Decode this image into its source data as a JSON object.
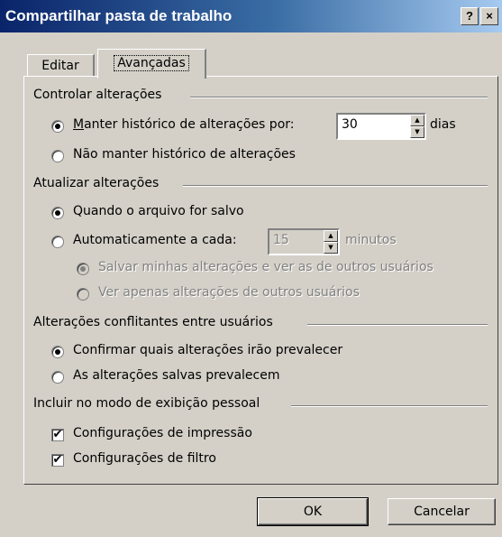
{
  "window": {
    "title": "Compartilhar pasta de trabalho",
    "help_label": "?",
    "close_label": "×"
  },
  "tabs": [
    {
      "label": "Editar"
    },
    {
      "label": "Avançadas"
    }
  ],
  "controlar": {
    "title": "Controlar alterações",
    "manter_historico": {
      "label": "Manter histórico de alterações por:",
      "checked": true
    },
    "dias_value": "30",
    "dias_label": "dias",
    "nao_manter": {
      "label": "Não manter histórico de alterações",
      "checked": false
    }
  },
  "atualizar": {
    "title": "Atualizar alterações",
    "quando_salvo": {
      "label": "Quando o arquivo for salvo",
      "checked": true
    },
    "automaticamente": {
      "label": "Automaticamente a cada:",
      "checked": false
    },
    "minutos_value": "15",
    "minutos_label": "minutos",
    "salvar_minhas": {
      "label": "Salvar minhas alterações e ver as de outros usuários",
      "checked": true,
      "disabled": true
    },
    "ver_apenas": {
      "label": "Ver apenas alterações de outros usuários",
      "checked": false,
      "disabled": true
    }
  },
  "conflitantes": {
    "title": "Alterações conflitantes entre usuários",
    "confirmar": {
      "label": "Confirmar quais alterações irão prevalecer",
      "checked": true
    },
    "salvas_prevalecem": {
      "label": "As alterações salvas prevalecem",
      "checked": false
    }
  },
  "incluir": {
    "title": "Incluir no modo de exibição pessoal",
    "impressao": {
      "label": "Configurações de impressão",
      "checked": true
    },
    "filtro": {
      "label": "Configurações de filtro",
      "checked": true
    }
  },
  "buttons": {
    "ok": "OK",
    "cancelar": "Cancelar"
  },
  "icons": {
    "radio_selected": "radio-dot",
    "checkbox_checked": "✔",
    "spin_up": "▲",
    "spin_down": "▼"
  },
  "colors": {
    "dialog_bg": "#d4d0c8",
    "title_start": "#0a246a",
    "title_end": "#a6caf0",
    "disabled_text": "#808080"
  }
}
